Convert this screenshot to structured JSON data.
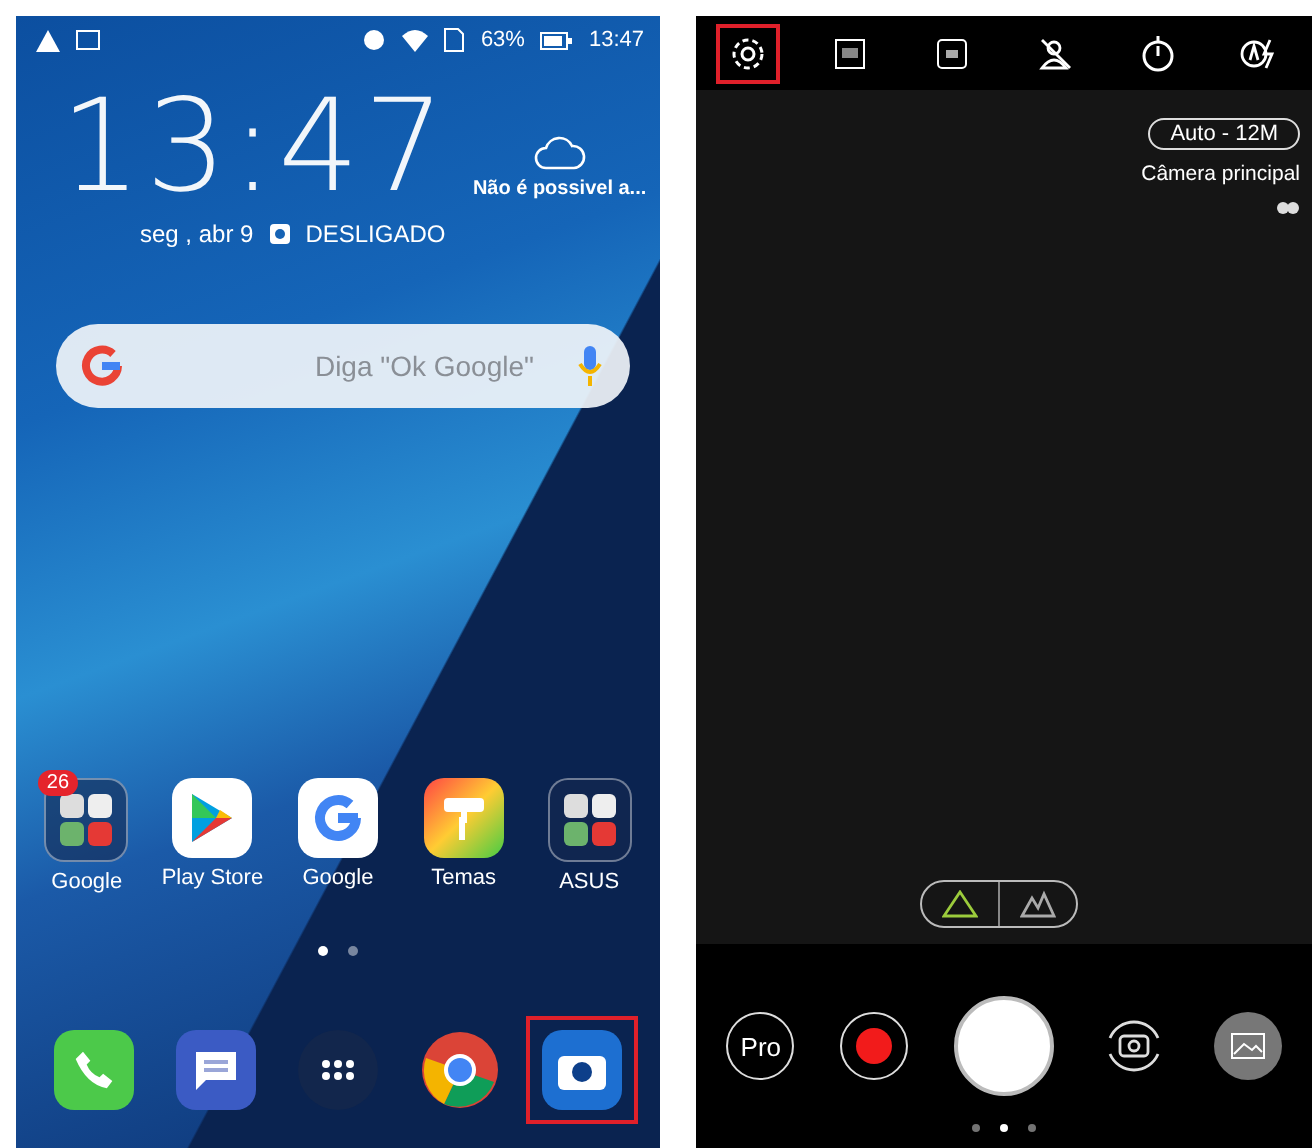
{
  "home_screen": {
    "status_bar": {
      "battery": "63%",
      "time": "13:47"
    },
    "clock": {
      "time": "13:47",
      "weather": "Não é possivel a...",
      "date": "seg , abr 9",
      "alarm": "DESLIGADO"
    },
    "search": {
      "placeholder": "Diga \"Ok Google\""
    },
    "apps": [
      {
        "label": "Google",
        "kind": "folder",
        "badge": "26"
      },
      {
        "label": "Play Store",
        "kind": "store"
      },
      {
        "label": "Google",
        "kind": "google"
      },
      {
        "label": "Temas",
        "kind": "themes"
      },
      {
        "label": "ASUS",
        "kind": "folder"
      }
    ],
    "page_dots": [
      {
        "selected": true
      },
      {
        "selected": false
      }
    ],
    "dock": [
      {
        "kind": "phone",
        "highlighted": false
      },
      {
        "kind": "messages",
        "highlighted": false
      },
      {
        "kind": "apps",
        "highlighted": false
      },
      {
        "kind": "browser",
        "highlighted": false
      },
      {
        "kind": "camera",
        "highlighted": true
      }
    ]
  },
  "camera_screen": {
    "toolbar": [
      {
        "kind": "settings",
        "highlighted": true
      },
      {
        "kind": "hdr",
        "highlighted": false
      },
      {
        "kind": "ratio",
        "highlighted": false
      },
      {
        "kind": "beauty",
        "highlighted": false
      },
      {
        "kind": "timer",
        "highlighted": false
      },
      {
        "kind": "flash",
        "highlighted": false
      }
    ],
    "resolution": "Auto - 12M",
    "camera": "Câmera principal",
    "modes": [
      {
        "kind": "single",
        "selected": true
      },
      {
        "kind": "wide",
        "selected": false
      }
    ],
    "controls": [
      {
        "kind": "pro",
        "label": "Pro"
      },
      {
        "kind": "record"
      },
      {
        "kind": "shutter"
      },
      {
        "kind": "switch"
      },
      {
        "kind": "gallery"
      }
    ],
    "page_dots": [
      {
        "selected": false
      },
      {
        "selected": true
      },
      {
        "selected": false
      }
    ]
  }
}
